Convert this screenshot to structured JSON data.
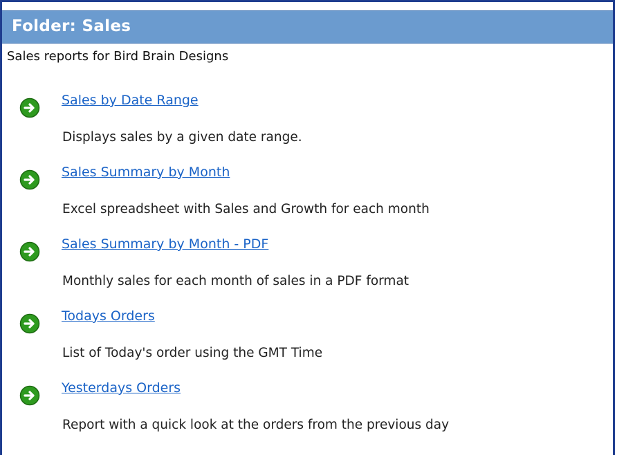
{
  "header": {
    "title": "Folder: Sales"
  },
  "folder": {
    "description": "Sales reports for Bird Brain Designs"
  },
  "reports": [
    {
      "title": "Sales by Date Range",
      "description": "Displays sales by a given date range.",
      "icon": "arrow-right-circle-icon"
    },
    {
      "title": "Sales Summary by Month",
      "description": "Excel spreadsheet with Sales and Growth for each month",
      "icon": "arrow-right-circle-icon"
    },
    {
      "title": "Sales Summary by Month - PDF",
      "description": "Monthly sales for each month of sales in a PDF format",
      "icon": "arrow-right-circle-icon"
    },
    {
      "title": "Todays Orders",
      "description": "List of Today's order using the GMT Time",
      "icon": "arrow-right-circle-icon"
    },
    {
      "title": "Yesterdays Orders",
      "description": "Report with a quick look at the orders from the previous day",
      "icon": "arrow-right-circle-icon"
    }
  ],
  "colors": {
    "header_bg": "#6b9bcf",
    "link": "#1a63c7",
    "icon_green": "#2e9a1f",
    "border": "#1f3d8f"
  }
}
